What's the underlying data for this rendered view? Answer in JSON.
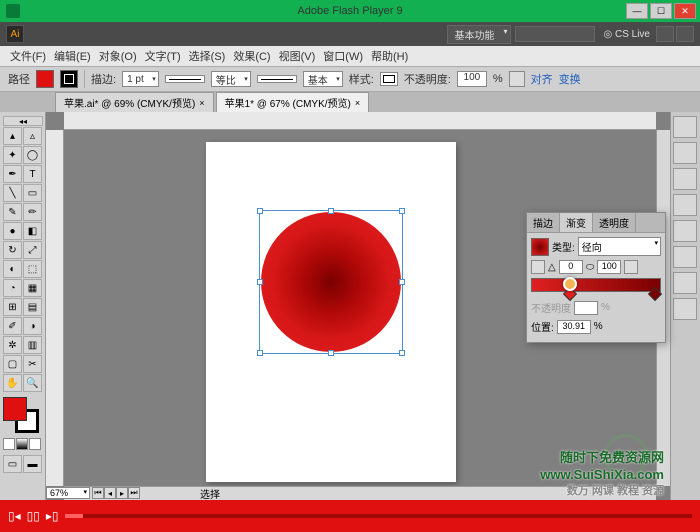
{
  "window": {
    "title": "Adobe Flash Player 9",
    "minimize": "—",
    "maximize": "☐",
    "close": "✕"
  },
  "app_bar": {
    "logo": "Ai",
    "workspace_dd": "基本功能",
    "cs_live": "◎ CS Live"
  },
  "menu": {
    "file": "文件(F)",
    "edit": "编辑(E)",
    "object": "对象(O)",
    "type": "文字(T)",
    "select": "选择(S)",
    "effect": "效果(C)",
    "view": "视图(V)",
    "window": "窗口(W)",
    "help": "帮助(H)"
  },
  "control": {
    "path_label": "路径",
    "stroke_label": "描边:",
    "stroke_weight": "1 pt",
    "uniform": "等比",
    "basic": "基本",
    "style_label": "样式:",
    "opacity_label": "不透明度:",
    "opacity_value": "100",
    "opacity_pct": "%",
    "align_label": "对齐",
    "transform_label": "变换"
  },
  "tabs": [
    {
      "label": "苹果.ai* @ 69% (CMYK/预览)"
    },
    {
      "label": "苹果1* @ 67% (CMYK/预览)"
    }
  ],
  "status": {
    "zoom": "67%",
    "mode": "选择"
  },
  "gradient_panel": {
    "tab_stroke": "描边",
    "tab_gradient": "渐变",
    "tab_transparency": "透明度",
    "type_label": "类型:",
    "type_value": "径向",
    "angle": "0",
    "ratio": "100",
    "opacity_label": "不透明度",
    "position_label": "位置:",
    "position_value": "30.91",
    "pct": "%"
  },
  "watermark": {
    "line1": "随时下免费资源网",
    "url": "www.SuiShiXia.com",
    "line2": "数万 网课 教程 资源"
  },
  "chart_data": {
    "type": "none"
  }
}
